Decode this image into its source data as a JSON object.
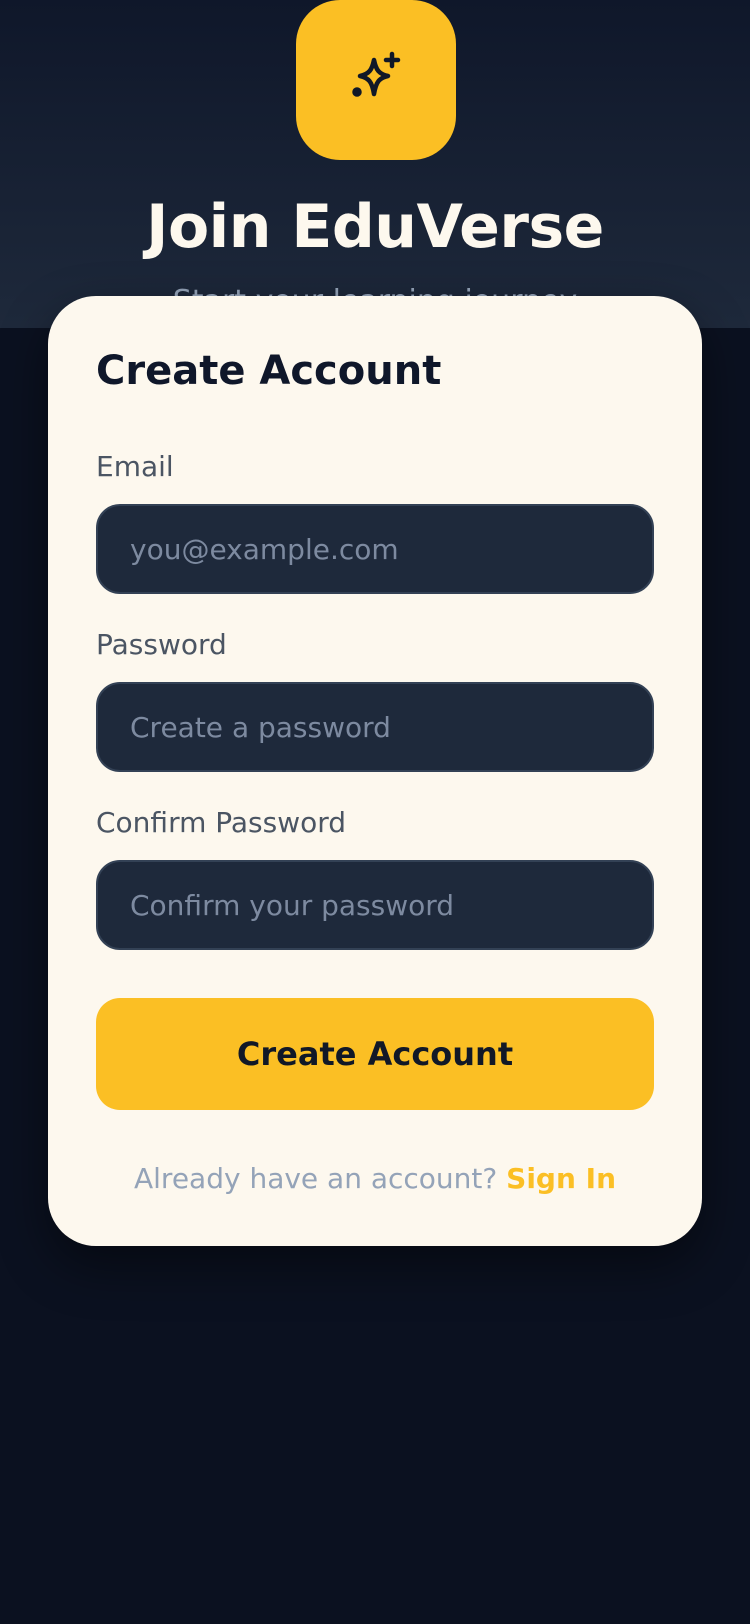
{
  "header": {
    "logo_icon": "sparkles-icon",
    "title": "Join EduVerse",
    "subtitle": "Start your learning journey"
  },
  "form": {
    "title": "Create Account",
    "fields": [
      {
        "label": "Email",
        "value": "",
        "placeholder": "you@example.com"
      },
      {
        "label": "Password",
        "value": "",
        "placeholder": "Create a password"
      },
      {
        "label": "Confirm Password",
        "value": "",
        "placeholder": "Confirm your password"
      }
    ],
    "submit_label": "Create Account",
    "footer_text": "Already have an account?",
    "signin_label": "Sign In"
  },
  "colors": {
    "background": "#0b1120",
    "accent": "#fbbf24",
    "card": "#fdf8ee",
    "input_bg": "#1e293b"
  }
}
